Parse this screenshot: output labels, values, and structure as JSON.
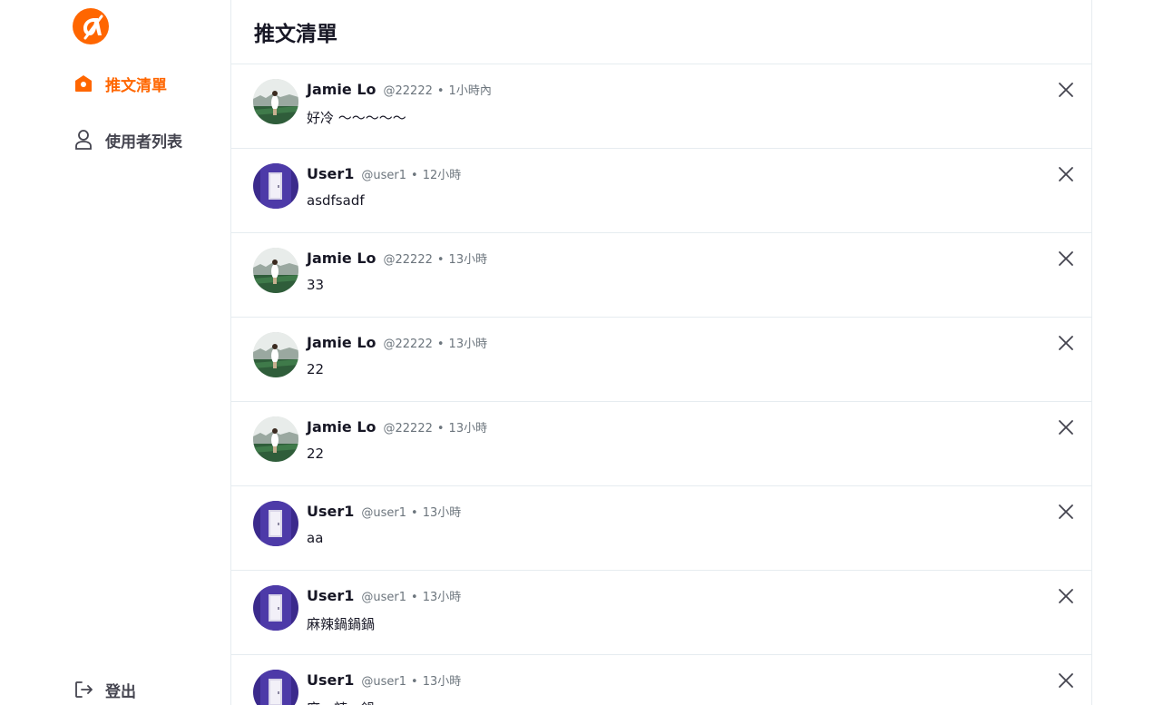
{
  "sidebar": {
    "logo_icon": "alphacamp-logo",
    "items": [
      {
        "label": "推文清單",
        "icon": "home-icon",
        "active": true
      },
      {
        "label": "使用者列表",
        "icon": "user-icon",
        "active": false
      }
    ],
    "logout_label": "登出",
    "logout_icon": "logout-icon"
  },
  "main": {
    "title": "推文清單"
  },
  "tweets": [
    {
      "name": "Jamie Lo",
      "account": "@22222",
      "separator": "•",
      "time": "1小時內",
      "content": "好冷 ～～～～～",
      "avatar": "photo"
    },
    {
      "name": "User1",
      "account": "@user1",
      "separator": "•",
      "time": "12小時",
      "content": "asdfsadf",
      "avatar": "door"
    },
    {
      "name": "Jamie Lo",
      "account": "@22222",
      "separator": "•",
      "time": "13小時",
      "content": "33",
      "avatar": "photo"
    },
    {
      "name": "Jamie Lo",
      "account": "@22222",
      "separator": "•",
      "time": "13小時",
      "content": "22",
      "avatar": "photo"
    },
    {
      "name": "Jamie Lo",
      "account": "@22222",
      "separator": "•",
      "time": "13小時",
      "content": "22",
      "avatar": "photo"
    },
    {
      "name": "User1",
      "account": "@user1",
      "separator": "•",
      "time": "13小時",
      "content": "aa",
      "avatar": "door"
    },
    {
      "name": "User1",
      "account": "@user1",
      "separator": "•",
      "time": "13小時",
      "content": "麻辣鍋鍋鍋",
      "avatar": "door"
    },
    {
      "name": "User1",
      "account": "@user1",
      "separator": "•",
      "time": "13小時",
      "content": "麻　辣　鍋",
      "avatar": "door"
    }
  ],
  "colors": {
    "brand": "#ff6600",
    "text": "#171725",
    "muted": "#6c757d",
    "border": "#e6ecf0"
  }
}
